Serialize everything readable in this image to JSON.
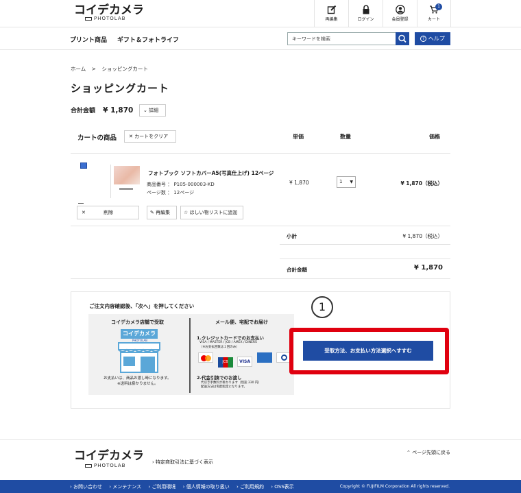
{
  "header": {
    "logo_main": "コイデカメラ",
    "logo_sub": "PHOTOLAB",
    "nav": [
      {
        "label": "再編集",
        "icon": "edit-icon"
      },
      {
        "label": "ログイン",
        "icon": "lock-icon"
      },
      {
        "label": "会員登録",
        "icon": "user-icon"
      },
      {
        "label": "カート",
        "icon": "cart-icon",
        "badge": "1"
      }
    ]
  },
  "menu": {
    "items": [
      "プリント商品",
      "ギフト＆フォトライフ"
    ],
    "search_placeholder": "キーワードを検索",
    "help_label": "ヘルプ"
  },
  "breadcrumb": {
    "home": "ホーム",
    "sep": ">",
    "current": "ショッピングカート"
  },
  "page_title": "ショッピングカート",
  "summary": {
    "total_label": "合計金額",
    "total_value": "¥ 1,870",
    "detail_label": "詳細"
  },
  "cart": {
    "label": "カートの商品",
    "clear_label": "カートをクリア",
    "columns": {
      "unit_price": "単価",
      "qty": "数量",
      "price": "価格"
    },
    "item": {
      "name": "フォトブック ソフトカバーA5(写真仕上げ) 12ページ",
      "code": "商品番号 ： P105-000003-KD",
      "pages": "ページ数 ： 12ページ",
      "unit_price": "¥ 1,870",
      "qty": "1",
      "price": "¥ 1,870（税込）",
      "delete_label": "削除",
      "reedit_label": "再編集",
      "wishlist_label": "ほしい物リストに追加"
    },
    "subtotal_label": "小計",
    "subtotal_value": "¥ 1,870（税込）",
    "grand_label": "合計金額",
    "grand_value": "¥ 1,870"
  },
  "checkout": {
    "instruction": "ご注文内容確認後、「次へ」を押してください",
    "store_title": "コイデカメラ店舗で受取",
    "store_logo": "コイデカメラ",
    "store_logo_sub": "PHOTOLAB",
    "store_note1": "お支払いは、商品お渡し時になります。",
    "store_note2": "※送料は掛かりません。",
    "mail_title": "メール便、宅配でお届け",
    "card_title": "1.クレジットカードでのお支払い",
    "card_brands": "VISA / MASTER / JCB / AMEX / DINERS",
    "card_note": "（※お支払回数は１回のみ）",
    "cod_title": "2.代金引換でのお渡し",
    "cod_note1": "代引き手数料が掛かります（別途 330 円）",
    "cod_note2": "配送方法は宅配指定になります。",
    "step_number": "1",
    "next_label": "受取方法、お支払い方法選択へすすむ"
  },
  "footer": {
    "logo_main": "コイデカメラ",
    "logo_sub": "PHOTOLAB",
    "legal_link": "特定商取引法に基づく表示",
    "pagetop": "ページ先頭に戻る",
    "links": [
      "お問い合わせ",
      "メンテナンス",
      "ご利用環境",
      "個人情報の取り扱い",
      "ご利用規約",
      "OSS表示"
    ],
    "copyright": "Copyright © FUJIFILM Corporation All rights reserved."
  },
  "colors": {
    "brand_blue": "#1f4ca3",
    "highlight_red": "#e0000f"
  }
}
